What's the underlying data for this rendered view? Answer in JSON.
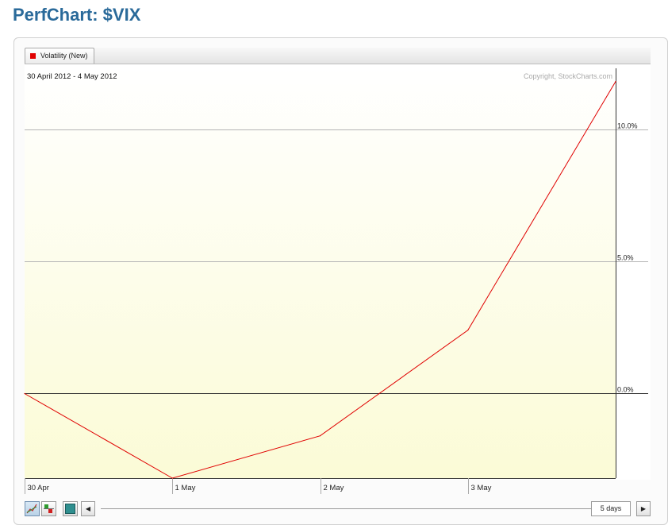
{
  "page": {
    "title": "PerfChart: $VIX"
  },
  "legend": {
    "label": "Volatility (New)",
    "color": "#e00000"
  },
  "chart_info": {
    "date_range": "30 April 2012 - 4 May 2012",
    "copyright": "Copyright, StockCharts.com"
  },
  "controls": {
    "range_label": "5 days",
    "line_chart_icon": "line-chart-icon",
    "histogram_icon": "histogram-icon",
    "panel_icon": "panel-toggle-icon",
    "left_arrow": "◀",
    "right_arrow": "▶"
  },
  "chart_data": {
    "type": "line",
    "title": "",
    "x": [
      "30 Apr",
      "1 May",
      "2 May",
      "3 May",
      "4 May"
    ],
    "x_tick_labels": [
      "30 Apr",
      "1 May",
      "2 May",
      "3 May"
    ],
    "series": [
      {
        "name": "Volatility (New)",
        "values": [
          0.0,
          -3.2,
          -1.6,
          2.4,
          11.8
        ]
      }
    ],
    "y_ticks": [
      0.0,
      5.0,
      10.0
    ],
    "y_tick_labels": [
      "0.0%",
      "5.0%",
      "10.0%"
    ],
    "ylim": [
      -3.2,
      12.3
    ],
    "grid": true,
    "legend": "top-left",
    "zero_line": true,
    "y_axis_side": "right",
    "fill_gradient": [
      "#ffffff",
      "#fbfbd6"
    ],
    "line_color": "#e00000"
  }
}
